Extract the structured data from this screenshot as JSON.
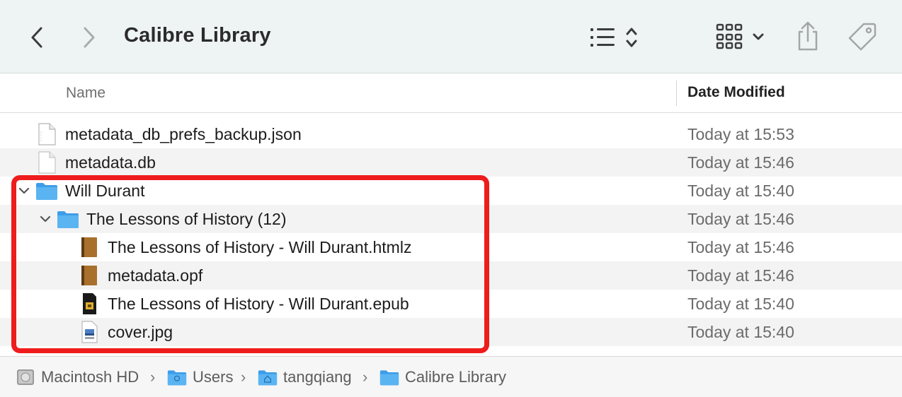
{
  "window": {
    "title": "Calibre Library"
  },
  "toolbar": {
    "back_icon": "chevron-left-icon",
    "forward_icon": "chevron-right-icon",
    "view_icon": "list-view-icon",
    "group_icon": "icon-grid-icon",
    "share_icon": "share-icon",
    "tag_icon": "tag-icon"
  },
  "columns": {
    "name": "Name",
    "date_modified": "Date Modified"
  },
  "files": [
    {
      "name": "metadata_db_prefs_backup.json",
      "date": "Today at 15:53",
      "kind": "document-icon",
      "level": 0
    },
    {
      "name": "metadata.db",
      "date": "Today at 15:46",
      "kind": "document-icon",
      "level": 0
    },
    {
      "name": "Will Durant",
      "date": "Today at 15:40",
      "kind": "folder-icon",
      "level": 0,
      "expanded": true
    },
    {
      "name": "The Lessons of History (12)",
      "date": "Today at 15:46",
      "kind": "folder-icon",
      "level": 1,
      "expanded": true
    },
    {
      "name": "The Lessons of History - Will Durant.htmlz",
      "date": "Today at 15:46",
      "kind": "book-icon",
      "level": 2
    },
    {
      "name": "metadata.opf",
      "date": "Today at 15:46",
      "kind": "book-icon",
      "level": 2
    },
    {
      "name": "The Lessons of History - Will Durant.epub",
      "date": "Today at 15:40",
      "kind": "epub-icon",
      "level": 2
    },
    {
      "name": "cover.jpg",
      "date": "Today at 15:40",
      "kind": "image-icon",
      "level": 2
    }
  ],
  "pathbar": [
    {
      "label": "Macintosh HD",
      "icon": "hard-drive-icon"
    },
    {
      "label": "Users",
      "icon": "folder-icon"
    },
    {
      "label": "tangqiang",
      "icon": "home-folder-icon"
    },
    {
      "label": "Calibre Library",
      "icon": "folder-icon"
    }
  ],
  "colors": {
    "highlight": "#ee1c1c",
    "folder": "#5ab4f2",
    "toolbar_bg": "#eef4f4"
  }
}
